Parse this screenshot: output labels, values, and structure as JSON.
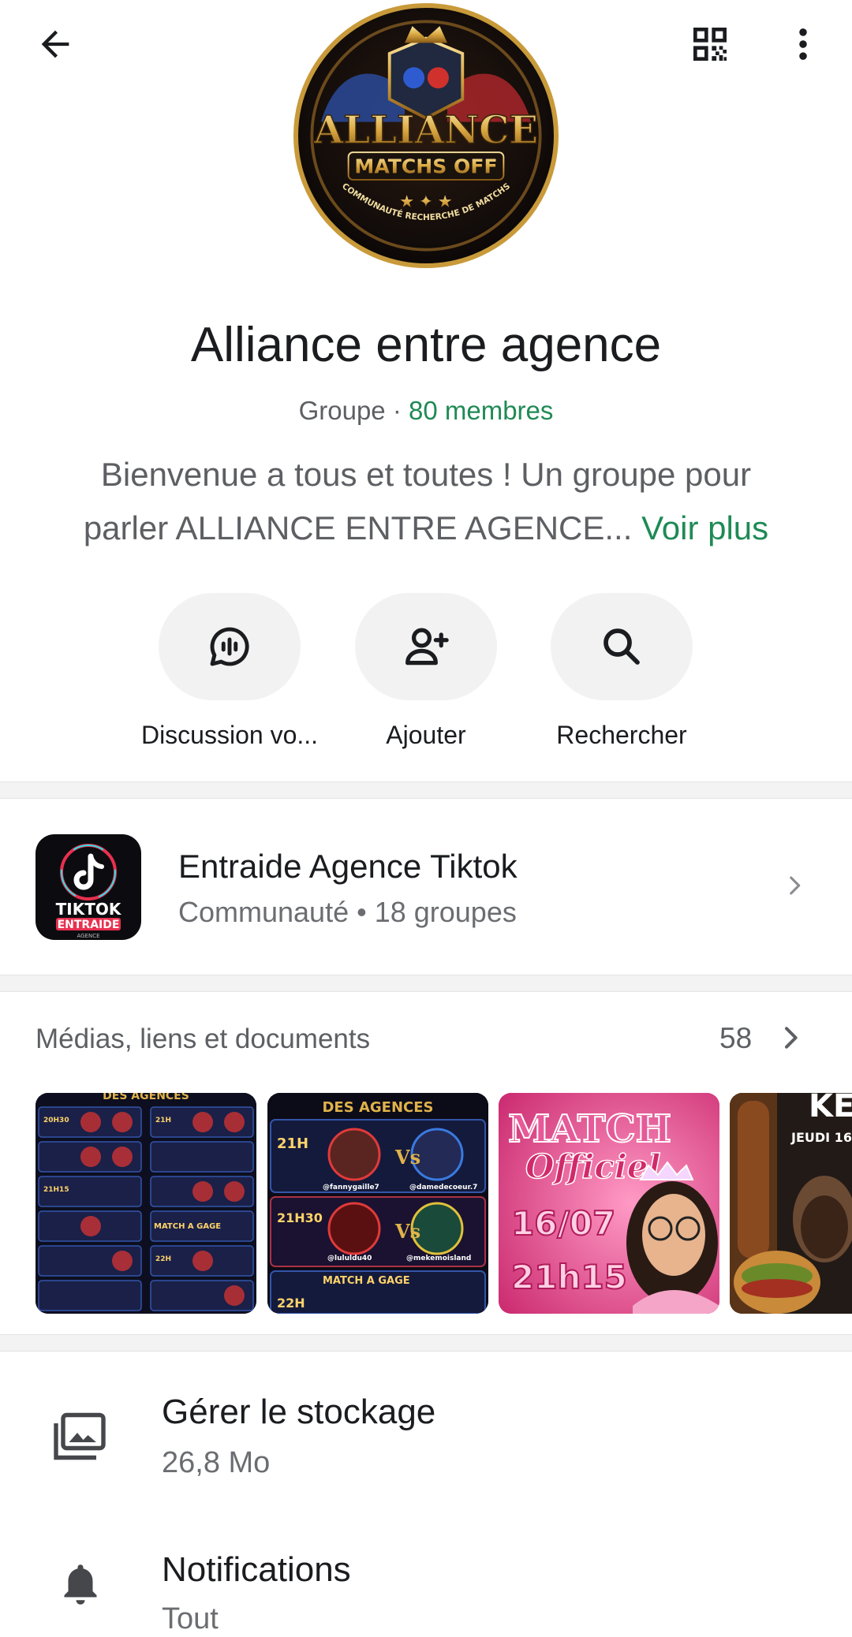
{
  "header": {
    "back_icon": "arrow-left-icon",
    "qr_icon": "qr-code-icon",
    "menu_icon": "more-vertical-icon",
    "avatar": {
      "logo_title": "ALLIANCE",
      "logo_subtitle": "MATCHS OFF",
      "logo_ring_text": "COMMUNAUTÉ RECHERCHE DE MATCHS"
    }
  },
  "group": {
    "name": "Alliance entre agence",
    "type_label": "Groupe",
    "separator": " · ",
    "members": "80 membres",
    "description": "Bienvenue a tous et toutes ! Un groupe pour parler ALLIANCE ENTRE AGENCE...",
    "see_more": "Voir plus"
  },
  "actions": [
    {
      "label": "Discussion vo...",
      "icon": "voice-chat-icon"
    },
    {
      "label": "Ajouter",
      "icon": "add-person-icon"
    },
    {
      "label": "Rechercher",
      "icon": "search-icon"
    }
  ],
  "community": {
    "title": "Entraide Agence Tiktok",
    "subtitle": "Communauté • 18 groupes",
    "icon_text_top": "TIKTOK",
    "icon_text_bottom": "ENTRAIDE",
    "icon_text_tiny": "AGENCE"
  },
  "media": {
    "title": "Médias, liens et documents",
    "count": "58",
    "thumbs": [
      {
        "lines": [
          "DES AGENCES",
          "20H30",
          "21H",
          "21H15",
          "MATCH A GAGE",
          "22H"
        ]
      },
      {
        "lines": [
          "DES AGENCES",
          "21H",
          "@fannygaille7",
          "@damedecoeur.7",
          "21H30",
          "@lululdu40",
          "@mekemoisland",
          "MATCH A GAGE",
          "22H"
        ]
      },
      {
        "lines": [
          "MATCH",
          "Officiel",
          "16/07",
          "21h15"
        ]
      },
      {
        "lines": [
          "KEB",
          "JEUDI 16"
        ]
      }
    ]
  },
  "settings": [
    {
      "title": "Gérer le stockage",
      "subtitle": "26,8 Mo",
      "icon": "photo-library-icon"
    },
    {
      "title": "Notifications",
      "subtitle": "Tout",
      "icon": "bell-icon"
    }
  ],
  "colors": {
    "accent_green": "#1f8a55",
    "text_primary": "#1b1c1f",
    "text_secondary": "#5d5f63",
    "pill_bg": "#f2f2f2"
  }
}
